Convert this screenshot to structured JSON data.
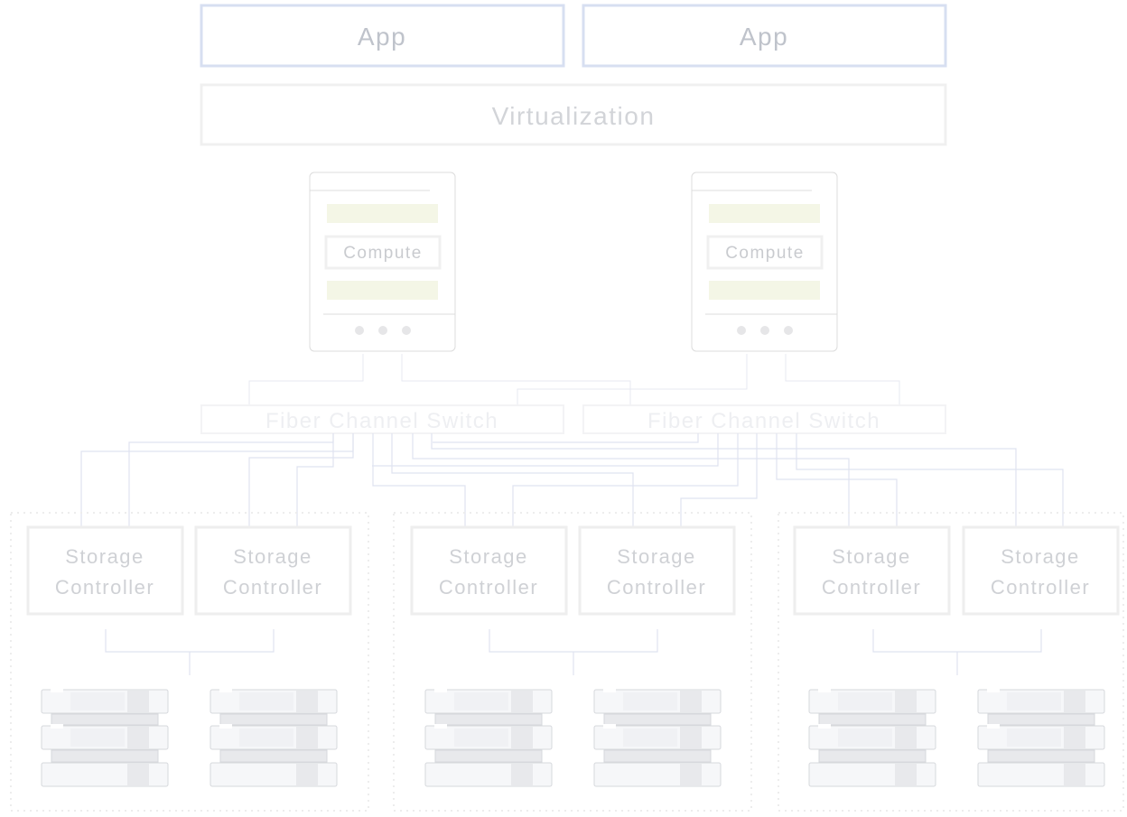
{
  "layers": {
    "apps": [
      {
        "label": "App"
      },
      {
        "label": "App"
      }
    ],
    "virtualization": {
      "label": "Virtualization"
    }
  },
  "compute_nodes": [
    {
      "label": "Compute"
    },
    {
      "label": "Compute"
    }
  ],
  "switches": [
    {
      "label": "Fiber Channel Switch"
    },
    {
      "label": "Fiber Channel Switch"
    }
  ],
  "storage_groups": [
    {
      "controllers": [
        {
          "line1": "Storage",
          "line2": "Controller"
        },
        {
          "line1": "Storage",
          "line2": "Controller"
        }
      ]
    },
    {
      "controllers": [
        {
          "line1": "Storage",
          "line2": "Controller"
        },
        {
          "line1": "Storage",
          "line2": "Controller"
        }
      ]
    },
    {
      "controllers": [
        {
          "line1": "Storage",
          "line2": "Controller"
        },
        {
          "line1": "Storage",
          "line2": "Controller"
        }
      ]
    }
  ],
  "colors": {
    "app_border": "#d7dff1",
    "app_text": "#bfc3cb",
    "virt_border": "#f0f0f0",
    "virt_text": "#d2d4d8",
    "node_border": "#dcdcdc",
    "compute_band": "#f4f6e6",
    "link": "#dfe3f0",
    "faint_link": "#eceef4",
    "switch_border": "#f3f3f5",
    "switch_text": "#eeeff2",
    "controller_border": "#eeeeee",
    "controller_text": "#cfd1d5",
    "group_dots": "#ededed",
    "disk_fill": "#f6f7f9",
    "disk_border": "#d6d8dc",
    "disk_accent": "#e8e9ec"
  }
}
